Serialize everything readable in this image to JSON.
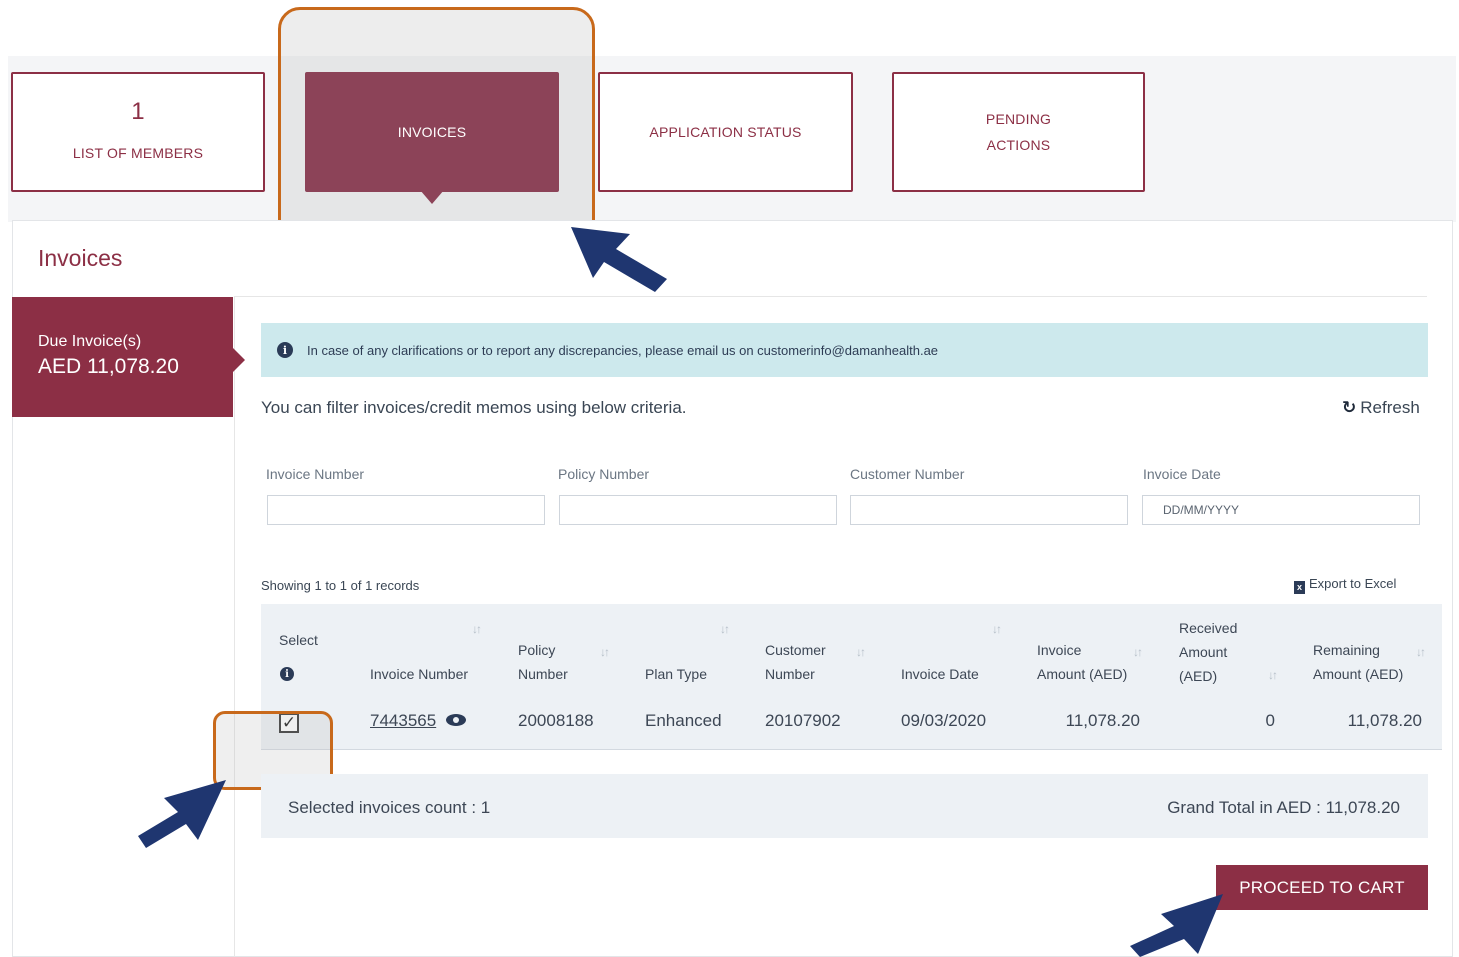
{
  "tabs": [
    {
      "count": "1",
      "label": "LIST OF MEMBERS",
      "active": false
    },
    {
      "label": "INVOICES",
      "active": true
    },
    {
      "label": "APPLICATION STATUS",
      "active": false
    },
    {
      "label_line1": "PENDING",
      "label_line2": "ACTIONS",
      "active": false
    }
  ],
  "panel": {
    "title": "Invoices",
    "due_label": "Due Invoice(s)",
    "due_amount": "AED 11,078.20"
  },
  "info": {
    "icon": "info-icon",
    "text": "In case of any clarifications or to report any discrepancies, please email us on customerinfo@damanhealth.ae"
  },
  "filter": {
    "hint": "You can filter invoices/credit memos using below criteria.",
    "refresh_label": "Refresh",
    "fields": [
      {
        "label": "Invoice Number",
        "value": "",
        "placeholder": ""
      },
      {
        "label": "Policy Number",
        "value": "",
        "placeholder": ""
      },
      {
        "label": "Customer Number",
        "value": "",
        "placeholder": ""
      },
      {
        "label": "Invoice Date",
        "value": "",
        "placeholder": "DD/MM/YYYY"
      }
    ]
  },
  "table": {
    "showing": "Showing 1 to 1 of 1 records",
    "export_label": "Export to Excel",
    "headers": {
      "select": "Select",
      "invoice_number": "Invoice Number",
      "policy_1": "Policy",
      "policy_2": "Number",
      "plan_type": "Plan Type",
      "customer_1": "Customer",
      "customer_2": "Number",
      "invoice_date": "Invoice Date",
      "invoice_amt_1": "Invoice",
      "invoice_amt_2": "Amount (AED)",
      "received_1": "Received",
      "received_2": "Amount",
      "received_3": "(AED)",
      "remaining_1": "Remaining",
      "remaining_2": "Amount (AED)"
    },
    "rows": [
      {
        "selected": true,
        "invoice_number": "7443565",
        "policy_number": "20008188",
        "plan_type": "Enhanced",
        "customer_number": "20107902",
        "invoice_date": "09/03/2020",
        "invoice_amount": "11,078.20",
        "received_amount": "0",
        "remaining_amount": "11,078.20"
      }
    ]
  },
  "summary": {
    "selected_count": "Selected invoices count : 1",
    "grand_total": "Grand Total in AED : 11,078.20"
  },
  "actions": {
    "proceed_label": "PROCEED TO CART"
  },
  "colors": {
    "brand": "#8c2f45",
    "active_tab": "#8c4358",
    "highlight": "#c8691b",
    "arrow": "#1f3670",
    "info_bg": "#cde9ed"
  }
}
